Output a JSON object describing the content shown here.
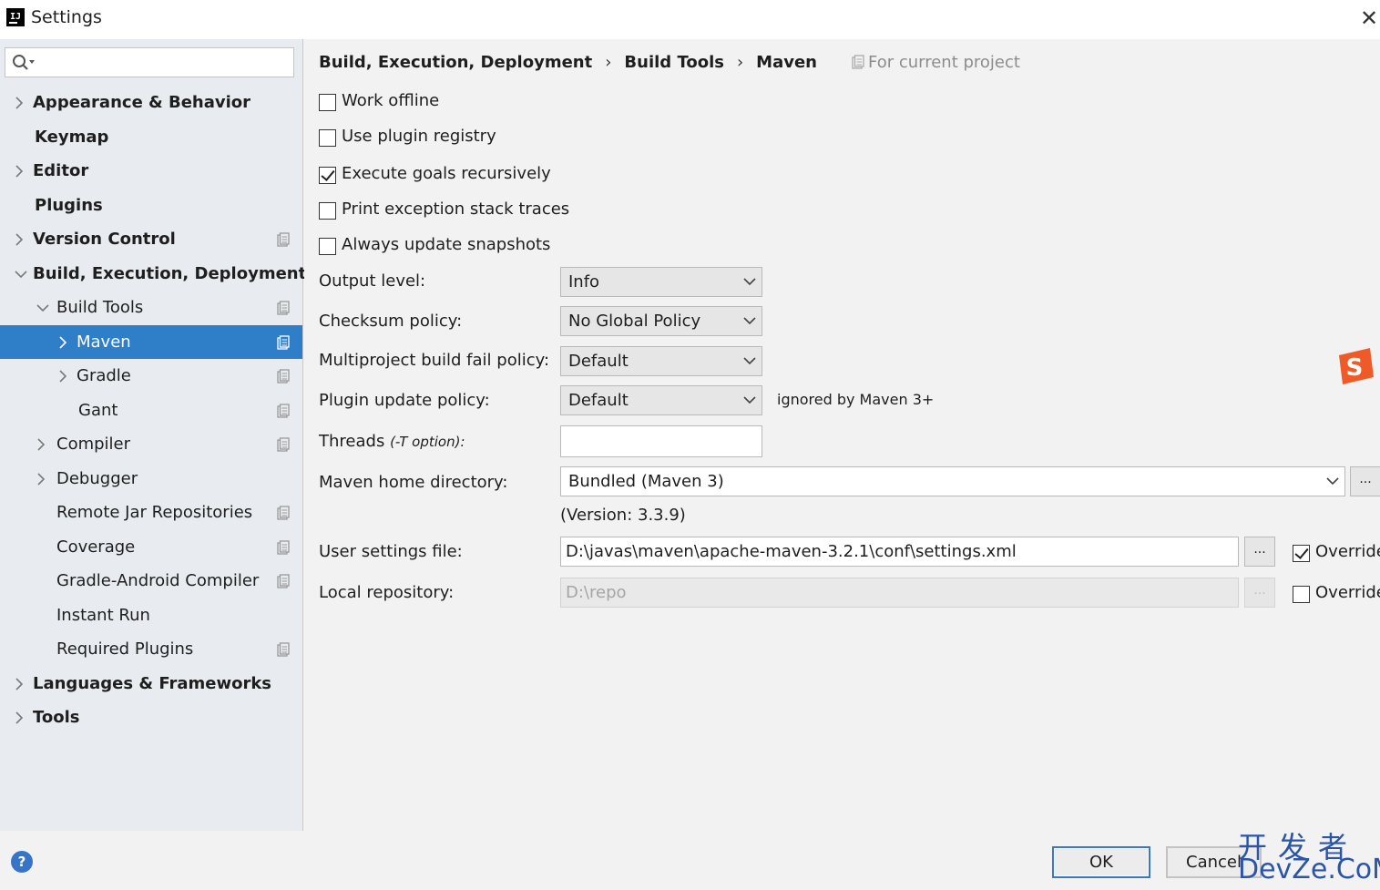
{
  "window": {
    "title": "Settings",
    "app_icon": "intellij-icon",
    "close": "close-icon"
  },
  "search": {
    "placeholder": "",
    "icon": "search-icon"
  },
  "tree": [
    {
      "label": "Appearance & Behavior",
      "level": 0,
      "bold": true,
      "arrow": "right",
      "project": false
    },
    {
      "label": "Keymap",
      "level": 0,
      "bold": true,
      "arrow": "none",
      "project": false
    },
    {
      "label": "Editor",
      "level": 0,
      "bold": true,
      "arrow": "right",
      "project": false
    },
    {
      "label": "Plugins",
      "level": 0,
      "bold": true,
      "arrow": "none",
      "project": false
    },
    {
      "label": "Version Control",
      "level": 0,
      "bold": true,
      "arrow": "right",
      "project": true
    },
    {
      "label": "Build, Execution, Deployment",
      "level": 0,
      "bold": true,
      "arrow": "down",
      "project": false
    },
    {
      "label": "Build Tools",
      "level": 1,
      "bold": false,
      "arrow": "down",
      "project": true
    },
    {
      "label": "Maven",
      "level": 2,
      "bold": false,
      "arrow": "right",
      "project": true,
      "selected": true
    },
    {
      "label": "Gradle",
      "level": 2,
      "bold": false,
      "arrow": "right",
      "project": true
    },
    {
      "label": "Gant",
      "level": 2,
      "bold": false,
      "arrow": "none",
      "project": true
    },
    {
      "label": "Compiler",
      "level": 1,
      "bold": false,
      "arrow": "right",
      "project": true
    },
    {
      "label": "Debugger",
      "level": 1,
      "bold": false,
      "arrow": "right",
      "project": false
    },
    {
      "label": "Remote Jar Repositories",
      "level": 1,
      "bold": false,
      "arrow": "none",
      "project": true
    },
    {
      "label": "Coverage",
      "level": 1,
      "bold": false,
      "arrow": "none",
      "project": true
    },
    {
      "label": "Gradle-Android Compiler",
      "level": 1,
      "bold": false,
      "arrow": "none",
      "project": true
    },
    {
      "label": "Instant Run",
      "level": 1,
      "bold": false,
      "arrow": "none",
      "project": false
    },
    {
      "label": "Required Plugins",
      "level": 1,
      "bold": false,
      "arrow": "none",
      "project": true
    },
    {
      "label": "Languages & Frameworks",
      "level": 0,
      "bold": true,
      "arrow": "right",
      "project": false
    },
    {
      "label": "Tools",
      "level": 0,
      "bold": true,
      "arrow": "right",
      "project": false
    }
  ],
  "breadcrumb": {
    "items": [
      "Build, Execution, Deployment",
      "Build Tools",
      "Maven"
    ],
    "separator": "›",
    "scope": "For current project"
  },
  "checkboxes": [
    {
      "label": "Work offline",
      "checked": false
    },
    {
      "label": "Use plugin registry",
      "checked": false
    },
    {
      "label": "Execute goals recursively",
      "checked": true
    },
    {
      "label": "Print exception stack traces",
      "checked": false
    },
    {
      "label": "Always update snapshots",
      "checked": false
    }
  ],
  "fields": {
    "output_level": {
      "label": "Output level:",
      "value": "Info"
    },
    "checksum_policy": {
      "label": "Checksum policy:",
      "value": "No Global Policy"
    },
    "multiproject_fail_policy": {
      "label": "Multiproject build fail policy:",
      "value": "Default"
    },
    "plugin_update_policy": {
      "label": "Plugin update policy:",
      "value": "Default",
      "note": "ignored by Maven 3+"
    },
    "threads": {
      "label": "Threads",
      "hint": "(-T option):",
      "value": ""
    },
    "maven_home": {
      "label": "Maven home directory:",
      "value": "Bundled (Maven 3)",
      "version": "(Version: 3.3.9)",
      "browse": "..."
    },
    "user_settings": {
      "label": "User settings file:",
      "value": "D:\\javas\\maven\\apache-maven-3.2.1\\conf\\settings.xml",
      "browse": "...",
      "override_label": "Override",
      "override_checked": true
    },
    "local_repo": {
      "label": "Local repository:",
      "value": "D:\\repo",
      "browse": "...",
      "override_label": "Override",
      "override_checked": false
    }
  },
  "buttons": {
    "ok": "OK",
    "cancel": "Cancel",
    "help": "?"
  },
  "watermark": {
    "cn": "开发者",
    "en": "DevZe.CoM"
  },
  "colors": {
    "selection": "#2f7ec8",
    "sidebar": "#e8ecf0",
    "panel": "#f2f2f2",
    "primary_border": "#3b78c4"
  }
}
